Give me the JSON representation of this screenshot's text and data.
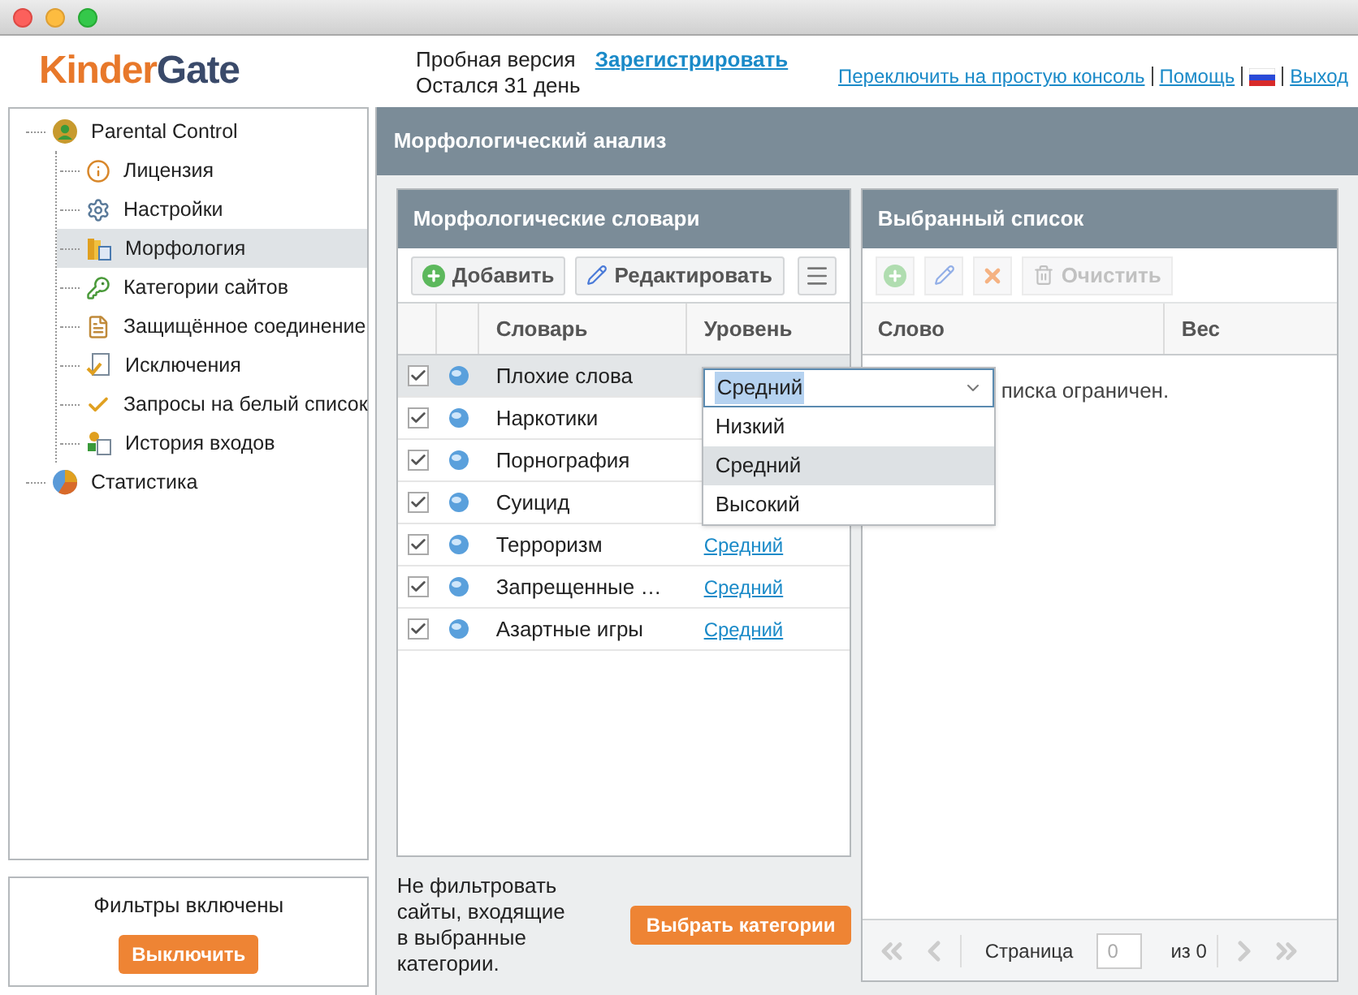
{
  "header": {
    "logo": [
      "Kinder",
      "Gate"
    ],
    "trial": {
      "label": "Пробная версия",
      "days": "Остался 31 день",
      "register_link": "Зарегистрировать"
    },
    "links": [
      "Переключить на простую консоль",
      "Помощь"
    ],
    "logout": "Выход"
  },
  "tree": [
    {
      "label": "Parental Control",
      "selected": false,
      "children": [
        {
          "label": "Лицензия",
          "selected": false
        },
        {
          "label": "Настройки",
          "selected": false
        },
        {
          "label": "Морфология",
          "selected": true
        },
        {
          "label": "Категории сайтов",
          "selected": false
        },
        {
          "label": "Защищённое соединение",
          "selected": false
        },
        {
          "label": "Исключения",
          "selected": false
        },
        {
          "label": "Запросы на белый список",
          "selected": false
        },
        {
          "label": "История входов",
          "selected": false
        }
      ]
    },
    {
      "label": "Статистика",
      "selected": false
    }
  ],
  "filter_box": {
    "status": "Фильтры включены",
    "button": "Выключить"
  },
  "main_title": "Морфологический анализ",
  "dictionaries": {
    "title": "Морфологические словари",
    "toolbar": [
      "Добавить",
      "Редактировать"
    ],
    "columns": [
      "Словарь",
      "Уровень"
    ],
    "rows": [
      {
        "checked": true,
        "name": "Плохие слова",
        "selected": true
      },
      {
        "checked": true,
        "name": "Наркотики",
        "selected": false
      },
      {
        "checked": true,
        "name": "Порнография",
        "selected": false
      },
      {
        "checked": true,
        "name": "Суицид",
        "selected": false
      },
      {
        "checked": true,
        "name": "Терроризм",
        "selected": false,
        "level": "Средний"
      },
      {
        "checked": true,
        "name": "Запрещенные …",
        "selected": false,
        "level": "Средний"
      },
      {
        "checked": true,
        "name": "Азартные игры",
        "selected": false,
        "level": "Средний"
      }
    ],
    "level_editor": {
      "value": "Средний",
      "options": [
        {
          "label": "Низкий",
          "selected": false
        },
        {
          "label": "Средний",
          "selected": true
        },
        {
          "label": "Высокий",
          "selected": false
        }
      ]
    }
  },
  "bottom_note": "Не фильтровать сайты, входящие в выбранные категории.",
  "choose_button": "Выбрать категории",
  "selected_list": {
    "title": "Выбранный список",
    "clear_button": "Очистить",
    "columns": [
      "Слово",
      "Вес"
    ],
    "empty_text": "писка ограничен.",
    "pager": {
      "label": "Страница",
      "page": "0",
      "of": "из 0"
    }
  }
}
